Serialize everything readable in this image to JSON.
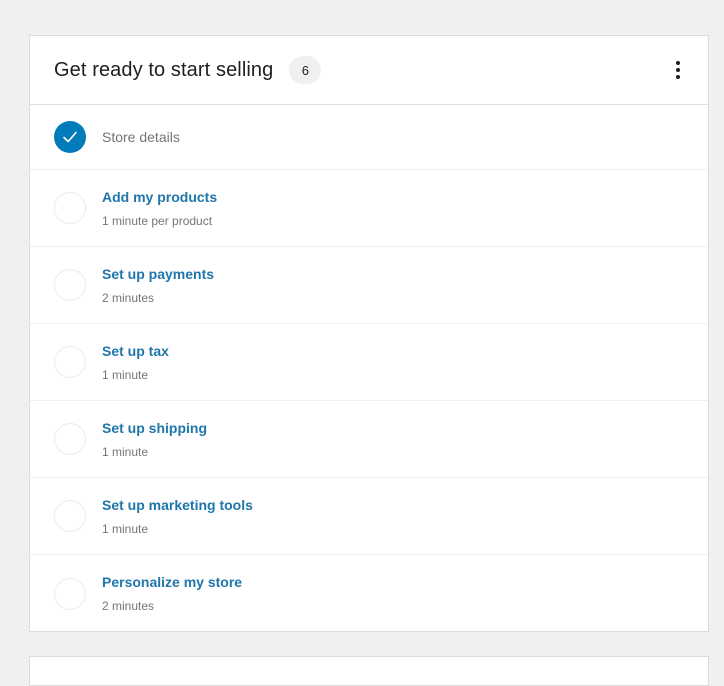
{
  "header": {
    "title": "Get ready to start selling",
    "badge_count": "6",
    "menu_icon": "more-vertical-icon"
  },
  "tasks": [
    {
      "title": "Store details",
      "time": "",
      "completed": true
    },
    {
      "title": "Add my products",
      "time": "1 minute per product",
      "completed": false
    },
    {
      "title": "Set up payments",
      "time": "2 minutes",
      "completed": false
    },
    {
      "title": "Set up tax",
      "time": "1 minute",
      "completed": false
    },
    {
      "title": "Set up shipping",
      "time": "1 minute",
      "completed": false
    },
    {
      "title": "Set up marketing tools",
      "time": "1 minute",
      "completed": false
    },
    {
      "title": "Personalize my store",
      "time": "2 minutes",
      "completed": false
    }
  ],
  "colors": {
    "accent": "#007cba",
    "link": "#1f76aa",
    "muted": "#757575"
  }
}
